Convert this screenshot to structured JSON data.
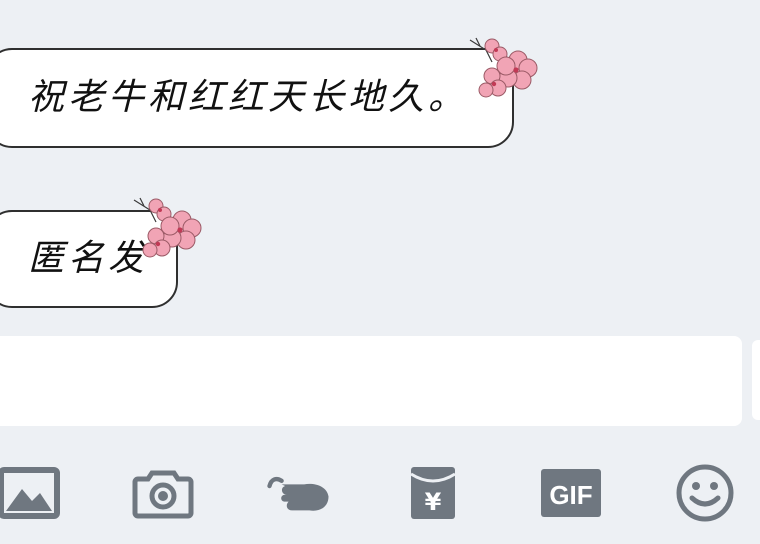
{
  "messages": [
    {
      "text": "祝老牛和红红天长地久。"
    },
    {
      "text": "匿名发"
    }
  ],
  "input": {
    "value": ""
  },
  "toolbar": {
    "items": [
      {
        "icon": "image-icon"
      },
      {
        "icon": "camera-icon"
      },
      {
        "icon": "poke-icon"
      },
      {
        "icon": "red-packet-icon",
        "glyph": "¥"
      },
      {
        "icon": "gif-icon",
        "label": "GIF"
      },
      {
        "icon": "emoji-icon"
      }
    ]
  },
  "colors": {
    "background": "#edf0f4",
    "icon": "#6f7780",
    "bubble_border": "#2f2f2f",
    "flower": "#f1a4b5"
  }
}
